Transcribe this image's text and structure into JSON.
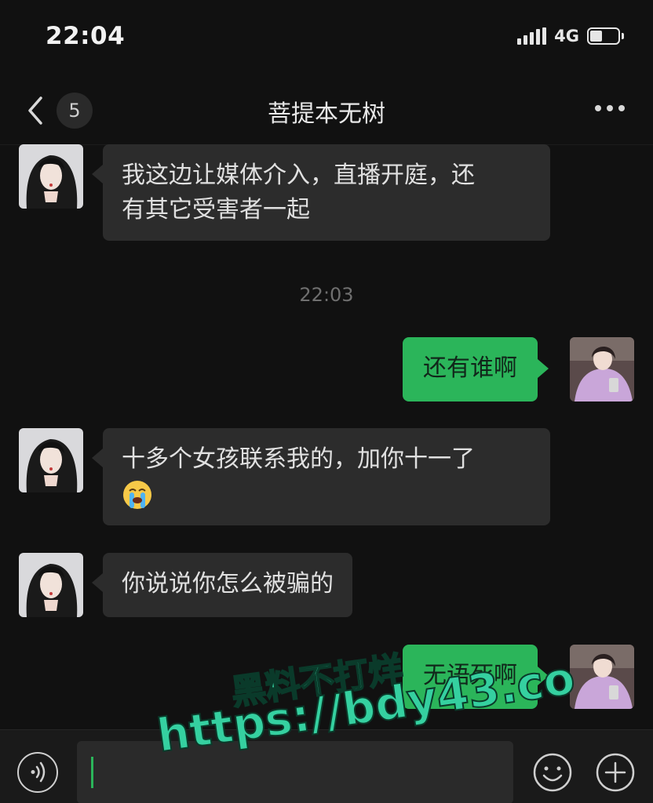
{
  "status_bar": {
    "time": "22:04",
    "network": "4G",
    "battery_level": 0.45
  },
  "nav": {
    "unread_count": "5",
    "title": "菩提本无树"
  },
  "messages": [
    {
      "side": "left",
      "text_line1": "我这边让媒体介入，直播开庭，还",
      "text_line2": "有其它受害者一起"
    },
    {
      "side": "center",
      "timestamp": "22:03"
    },
    {
      "side": "right",
      "text": "还有谁啊"
    },
    {
      "side": "left",
      "text_line1": "十多个女孩联系我的，加你十一了",
      "emoji": "loudly-crying-emoji"
    },
    {
      "side": "left",
      "text": "你说说你怎么被骗的"
    },
    {
      "side": "right",
      "text": "无语死啊"
    }
  ],
  "watermark": {
    "line1": "黑料不打烊",
    "line2": "https://bdy43.co"
  },
  "input_bar": {
    "voice_icon": "voice-icon",
    "emoji_icon": "smile-icon",
    "plus_icon": "plus-icon"
  },
  "colors": {
    "background": "#111111",
    "incoming_bubble": "#2c2c2c",
    "outgoing_bubble": "#2bb55a",
    "watermark": "#35d0a0"
  }
}
